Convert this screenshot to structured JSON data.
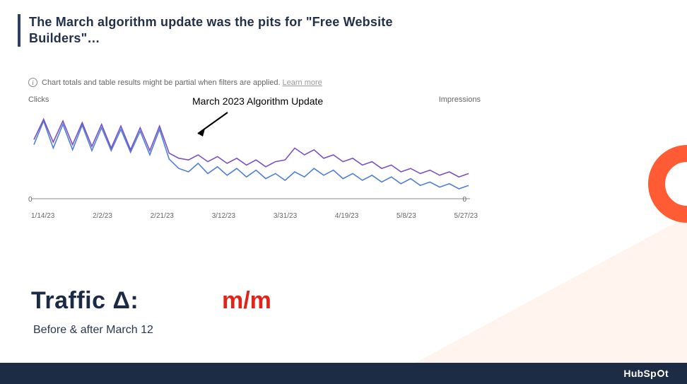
{
  "title": "The March algorithm update was the pits for \"Free Website Builders\"…",
  "info_notice": "Chart totals and table results might be partial when filters are applied.",
  "learn_more": "Learn more",
  "axis_left": "Clicks",
  "axis_right": "Impressions",
  "axis_zero_left": "0",
  "axis_zero_right": "0",
  "annotation": "March 2023 Algorithm Update",
  "x_ticks": [
    "1/14/23",
    "2/2/23",
    "2/21/23",
    "3/12/23",
    "3/31/23",
    "4/19/23",
    "5/8/23",
    "5/27/23"
  ],
  "traffic_label": "Traffic Δ:",
  "mm": "m/m",
  "subline": "Before & after March 12",
  "logo_text_a": "HubSp",
  "logo_text_b": "t",
  "chart_data": {
    "type": "line",
    "title": "",
    "xlabel": "",
    "ylabel_left": "Clicks",
    "ylabel_right": "Impressions",
    "annotations": [
      {
        "text": "March 2023 Algorithm Update",
        "x": "~2/28/23"
      }
    ],
    "x": [
      "1/14/23",
      "2/2/23",
      "2/21/23",
      "3/12/23",
      "3/31/23",
      "4/19/23",
      "5/8/23",
      "5/27/23"
    ],
    "series": [
      {
        "name": "Clicks",
        "color": "#4f7fd9",
        "axis": "left",
        "values_relative": [
          0.62,
          0.9,
          0.58,
          0.86,
          0.56,
          0.85,
          0.55,
          0.82,
          0.55,
          0.8,
          0.53,
          0.78,
          0.5,
          0.8,
          0.45,
          0.34,
          0.3,
          0.4,
          0.28,
          0.36,
          0.26,
          0.34,
          0.24,
          0.32,
          0.22,
          0.28,
          0.2,
          0.3,
          0.24,
          0.34,
          0.26,
          0.32,
          0.22,
          0.28,
          0.2,
          0.26,
          0.18,
          0.24,
          0.16,
          0.22,
          0.14,
          0.18,
          0.12,
          0.16,
          0.1,
          0.14
        ]
      },
      {
        "name": "Impressions",
        "color": "#7a4fc4",
        "axis": "right",
        "values_relative": [
          0.68,
          0.92,
          0.65,
          0.9,
          0.62,
          0.88,
          0.6,
          0.86,
          0.58,
          0.84,
          0.56,
          0.82,
          0.55,
          0.84,
          0.52,
          0.46,
          0.44,
          0.5,
          0.42,
          0.48,
          0.4,
          0.46,
          0.38,
          0.44,
          0.36,
          0.42,
          0.44,
          0.58,
          0.5,
          0.56,
          0.46,
          0.5,
          0.42,
          0.46,
          0.38,
          0.42,
          0.34,
          0.38,
          0.3,
          0.34,
          0.28,
          0.32,
          0.26,
          0.3,
          0.24,
          0.28
        ]
      }
    ],
    "note": "values_relative are fractions of each axis max read off an unlabeled chart (0=baseline, 1=top); absolute scales were redacted in the screenshot."
  }
}
